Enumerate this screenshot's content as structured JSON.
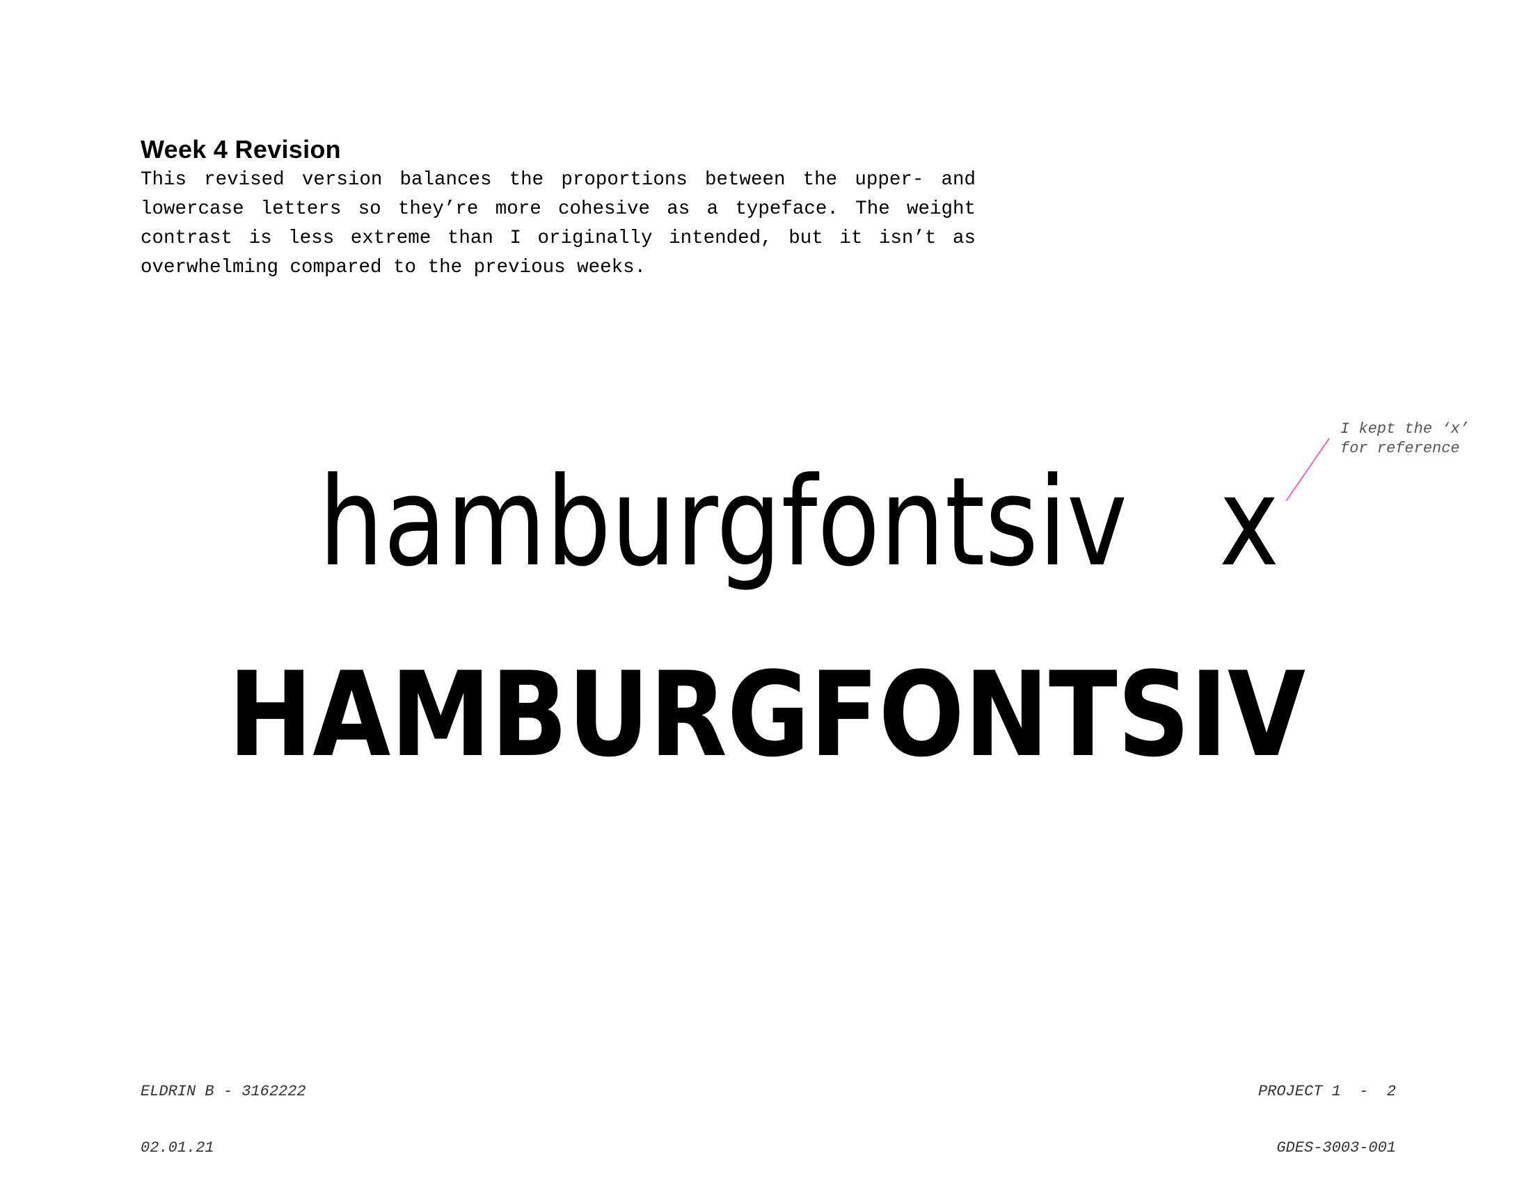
{
  "header": {
    "title": "Week 4 Revision",
    "description": "This revised version balances the proportions between the upper- and lowercase letters so they’re more cohesive as a typeface. The weight contrast is less extreme than I originally intended, but it isn’t as overwhelming compared to the previous weeks."
  },
  "specimen": {
    "lowercase": "hamburgfontsiv",
    "reference_glyph": "x",
    "uppercase": "HAMBURGFONTSIV"
  },
  "annotation": {
    "line1": "I kept the ‘x’",
    "line2": "for reference",
    "color": "#ff33cc"
  },
  "footer": {
    "author": "ELDRIN B - 3162222",
    "date": "02.01.21",
    "project": "PROJECT 1  -  2",
    "course": "GDES-3003-001"
  }
}
